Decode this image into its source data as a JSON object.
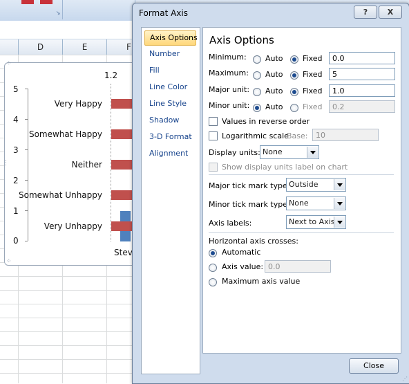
{
  "excel": {
    "columns": [
      "D",
      "E",
      "F"
    ]
  },
  "chart": {
    "y_ticks": [
      "5",
      "4",
      "3",
      "2",
      "1",
      "0"
    ],
    "top_label": "1.2",
    "categories": [
      "Very Happy",
      "Somewhat Happy",
      "Neither",
      "Somewhat Unhappy",
      "Very Unhappy"
    ],
    "x_label": "Steve",
    "colors": {
      "bars": "#c0504d",
      "blue_bar": "#4f81bd"
    }
  },
  "dialog": {
    "title": "Format Axis",
    "help_icon": "?",
    "close_icon": "X",
    "nav": [
      "Axis Options",
      "Number",
      "Fill",
      "Line Color",
      "Line Style",
      "Shadow",
      "3-D Format",
      "Alignment"
    ],
    "panel_title": "Axis Options",
    "rows": [
      {
        "label": "Minimum:",
        "auto": "Auto",
        "fixed": "Fixed",
        "value": "0.0",
        "selected": "fixed"
      },
      {
        "label": "Maximum:",
        "auto": "Auto",
        "fixed": "Fixed",
        "value": "5",
        "selected": "fixed"
      },
      {
        "label": "Major unit:",
        "auto": "Auto",
        "fixed": "Fixed",
        "value": "1.0",
        "selected": "fixed"
      },
      {
        "label": "Minor unit:",
        "auto": "Auto",
        "fixed": "Fixed",
        "value": "0.2",
        "selected": "auto"
      }
    ],
    "values_reverse": "Values in reverse order",
    "log_scale": "Logarithmic scale",
    "base_label": "Base:",
    "base_value": "10",
    "display_units_label": "Display units:",
    "display_units_value": "None",
    "show_units_label": "Show display units label on chart",
    "major_tick_label": "Major tick mark type:",
    "major_tick_value": "Outside",
    "minor_tick_label": "Minor tick mark type:",
    "minor_tick_value": "None",
    "axis_labels_label": "Axis labels:",
    "axis_labels_value": "Next to Axis",
    "crosses_title": "Horizontal axis crosses:",
    "crosses_auto": "Automatic",
    "crosses_value_label": "Axis value:",
    "crosses_value": "0.0",
    "crosses_max": "Maximum axis value",
    "close_button": "Close"
  }
}
